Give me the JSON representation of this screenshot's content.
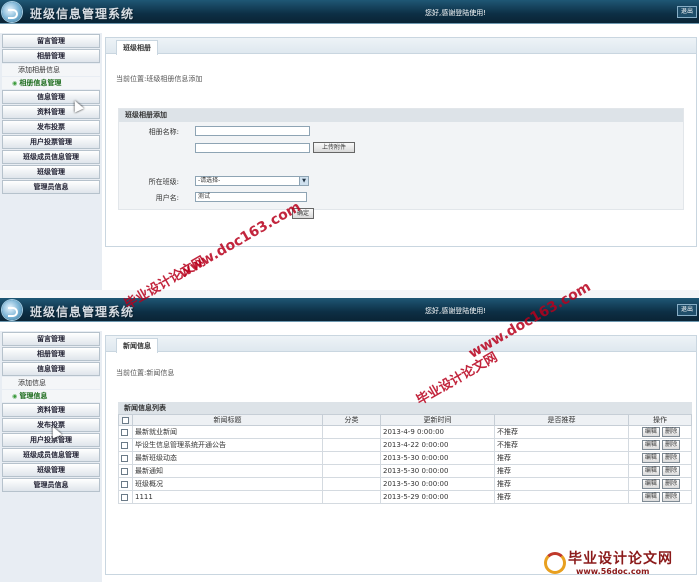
{
  "app_title": "班级信息管理系统",
  "welcome": "您好,感谢登陆使用!",
  "exit_label": "退出",
  "screen1": {
    "nav": [
      {
        "label": "留言管理",
        "type": "item"
      },
      {
        "label": "相册管理",
        "type": "item"
      },
      {
        "label": "添加相册信息",
        "type": "sub"
      },
      {
        "label": "相册信息管理",
        "type": "sub-active"
      },
      {
        "label": "信息管理",
        "type": "item"
      },
      {
        "label": "资料管理",
        "type": "item"
      },
      {
        "label": "发布投票",
        "type": "item"
      },
      {
        "label": "用户投票管理",
        "type": "item"
      },
      {
        "label": "班级成员信息管理",
        "type": "item"
      },
      {
        "label": "班级管理",
        "type": "item"
      },
      {
        "label": "管理员信息",
        "type": "item"
      }
    ],
    "tab": "班级相册",
    "breadcrumb": "当前位置:班级相册信息添加",
    "section_title": "班级相册添加",
    "album_name_label": "相册名称:",
    "album_name_value": "",
    "attachment_value": "",
    "upload_label": "上传附件",
    "class_label": "所在班级:",
    "class_value": "-请选择-",
    "username_label": "用户名:",
    "username_value": "测试",
    "confirm_label": "确定"
  },
  "screen2": {
    "nav": [
      {
        "label": "留言管理",
        "type": "item"
      },
      {
        "label": "相册管理",
        "type": "item"
      },
      {
        "label": "信息管理",
        "type": "item"
      },
      {
        "label": "添加信息",
        "type": "sub"
      },
      {
        "label": "管理信息",
        "type": "sub-active"
      },
      {
        "label": "资料管理",
        "type": "item"
      },
      {
        "label": "发布投票",
        "type": "item"
      },
      {
        "label": "用户投票管理",
        "type": "item"
      },
      {
        "label": "班级成员信息管理",
        "type": "item"
      },
      {
        "label": "班级管理",
        "type": "item"
      },
      {
        "label": "管理员信息",
        "type": "item"
      }
    ],
    "tab": "新闻信息",
    "breadcrumb": "当前位置:新闻信息",
    "section_title": "新闻信息列表",
    "columns": [
      "",
      "新闻标题",
      "分类",
      "更新时间",
      "是否推荐",
      "操作"
    ],
    "rows": [
      {
        "title": "最新就业新闻",
        "category": "",
        "time": "2013-4-9 0:00:00",
        "recommend": "不推荐"
      },
      {
        "title": "毕设生信息管理系统开通公告",
        "category": "",
        "time": "2013-4-22 0:00:00",
        "recommend": "不推荐"
      },
      {
        "title": "最新班级动态",
        "category": "",
        "time": "2013-5-30 0:00:00",
        "recommend": "推荐"
      },
      {
        "title": "最新通知",
        "category": "",
        "time": "2013-5-30 0:00:00",
        "recommend": "推荐"
      },
      {
        "title": "班级概况",
        "category": "",
        "time": "2013-5-30 0:00:00",
        "recommend": "推荐"
      },
      {
        "title": "1111",
        "category": "",
        "time": "2013-5-29 0:00:00",
        "recommend": "推荐"
      }
    ],
    "edit_label": "编辑",
    "delete_label": "删除"
  },
  "watermarks": {
    "site": "www.doc163.com",
    "cn": "毕业设计论文网",
    "stamp_cn": "毕业设计论文网",
    "stamp_url": "www.56doc.com"
  },
  "colors": {
    "header": "#0d2f45",
    "watermark": "#b8001c",
    "active_nav": "#1b6b1b"
  }
}
